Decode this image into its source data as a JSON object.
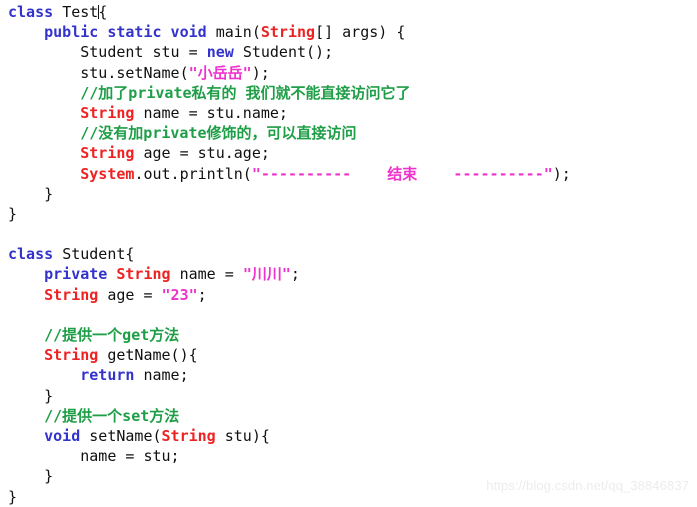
{
  "editor": {
    "language": "java",
    "colors": {
      "background": "#ffffff",
      "plain": "#101010",
      "keyword": "#3333cc",
      "type": "#ee2222",
      "string": "#ee33cc",
      "comment": "#1e9e46",
      "watermark": "#ececec"
    },
    "cursor": {
      "line": 1,
      "after_text": "class Test"
    },
    "lines": [
      {
        "n": 1,
        "tokens": [
          {
            "t": "class ",
            "k": "kw"
          },
          {
            "t": "Test",
            "k": "pln"
          },
          {
            "t": "CURSOR",
            "k": "cursor"
          },
          {
            "t": "{",
            "k": "pln"
          }
        ]
      },
      {
        "n": 2,
        "tokens": [
          {
            "t": "    ",
            "k": "pln"
          },
          {
            "t": "public static void ",
            "k": "kw"
          },
          {
            "t": "main(",
            "k": "pln"
          },
          {
            "t": "String",
            "k": "type"
          },
          {
            "t": "[] args) {",
            "k": "pln"
          }
        ]
      },
      {
        "n": 3,
        "tokens": [
          {
            "t": "        Student stu = ",
            "k": "pln"
          },
          {
            "t": "new ",
            "k": "kw"
          },
          {
            "t": "Student();",
            "k": "pln"
          }
        ]
      },
      {
        "n": 4,
        "tokens": [
          {
            "t": "        stu.setName(",
            "k": "pln"
          },
          {
            "t": "\"小岳岳\"",
            "k": "str"
          },
          {
            "t": ");",
            "k": "pln"
          }
        ]
      },
      {
        "n": 5,
        "tokens": [
          {
            "t": "        ",
            "k": "pln"
          },
          {
            "t": "//加了private私有的 我们就不能直接访问它了",
            "k": "cmt"
          }
        ]
      },
      {
        "n": 6,
        "tokens": [
          {
            "t": "        ",
            "k": "pln"
          },
          {
            "t": "String",
            "k": "type"
          },
          {
            "t": " name = stu.name;",
            "k": "pln"
          }
        ]
      },
      {
        "n": 7,
        "tokens": [
          {
            "t": "        ",
            "k": "pln"
          },
          {
            "t": "//没有加private修饰的，可以直接访问",
            "k": "cmt"
          }
        ]
      },
      {
        "n": 8,
        "tokens": [
          {
            "t": "        ",
            "k": "pln"
          },
          {
            "t": "String",
            "k": "type"
          },
          {
            "t": " age = stu.age;",
            "k": "pln"
          }
        ]
      },
      {
        "n": 9,
        "tokens": [
          {
            "t": "        ",
            "k": "pln"
          },
          {
            "t": "System",
            "k": "type"
          },
          {
            "t": ".out.println(",
            "k": "pln"
          },
          {
            "t": "\"----------    结束    ----------\"",
            "k": "str"
          },
          {
            "t": ");",
            "k": "pln"
          }
        ]
      },
      {
        "n": 10,
        "tokens": [
          {
            "t": "    }",
            "k": "pln"
          }
        ]
      },
      {
        "n": 11,
        "tokens": [
          {
            "t": "}",
            "k": "pln"
          }
        ]
      },
      {
        "n": 12,
        "tokens": []
      },
      {
        "n": 13,
        "tokens": [
          {
            "t": "class ",
            "k": "kw"
          },
          {
            "t": "Student{",
            "k": "pln"
          }
        ]
      },
      {
        "n": 14,
        "tokens": [
          {
            "t": "    ",
            "k": "pln"
          },
          {
            "t": "private ",
            "k": "kw"
          },
          {
            "t": "String",
            "k": "type"
          },
          {
            "t": " name = ",
            "k": "pln"
          },
          {
            "t": "\"川川\"",
            "k": "str"
          },
          {
            "t": ";",
            "k": "pln"
          }
        ]
      },
      {
        "n": 15,
        "tokens": [
          {
            "t": "    ",
            "k": "pln"
          },
          {
            "t": "String",
            "k": "type"
          },
          {
            "t": " age = ",
            "k": "pln"
          },
          {
            "t": "\"23\"",
            "k": "str"
          },
          {
            "t": ";",
            "k": "pln"
          }
        ]
      },
      {
        "n": 16,
        "tokens": []
      },
      {
        "n": 17,
        "tokens": [
          {
            "t": "    ",
            "k": "pln"
          },
          {
            "t": "//提供一个get方法",
            "k": "cmt"
          }
        ]
      },
      {
        "n": 18,
        "tokens": [
          {
            "t": "    ",
            "k": "pln"
          },
          {
            "t": "String",
            "k": "type"
          },
          {
            "t": " getName(){",
            "k": "pln"
          }
        ]
      },
      {
        "n": 19,
        "tokens": [
          {
            "t": "        ",
            "k": "pln"
          },
          {
            "t": "return ",
            "k": "kw"
          },
          {
            "t": "name;",
            "k": "pln"
          }
        ]
      },
      {
        "n": 20,
        "tokens": [
          {
            "t": "    }",
            "k": "pln"
          }
        ]
      },
      {
        "n": 21,
        "tokens": [
          {
            "t": "    ",
            "k": "pln"
          },
          {
            "t": "//提供一个set方法",
            "k": "cmt"
          }
        ]
      },
      {
        "n": 22,
        "tokens": [
          {
            "t": "    ",
            "k": "pln"
          },
          {
            "t": "void ",
            "k": "kw"
          },
          {
            "t": "setName(",
            "k": "pln"
          },
          {
            "t": "String",
            "k": "type"
          },
          {
            "t": " stu){",
            "k": "pln"
          }
        ]
      },
      {
        "n": 23,
        "tokens": [
          {
            "t": "        name = stu;",
            "k": "pln"
          }
        ]
      },
      {
        "n": 24,
        "tokens": [
          {
            "t": "    }",
            "k": "pln"
          }
        ]
      },
      {
        "n": 25,
        "tokens": [
          {
            "t": "}",
            "k": "pln"
          }
        ]
      }
    ]
  },
  "watermark": {
    "text": "https://blog.csdn.net/qq_38846837"
  }
}
